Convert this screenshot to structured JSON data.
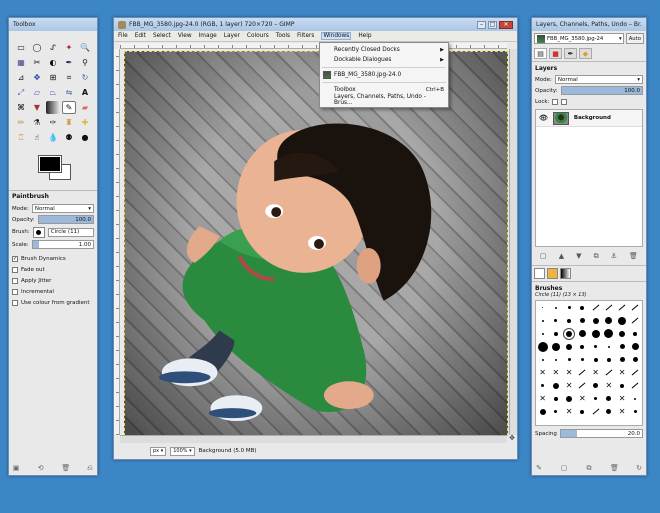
{
  "toolbox": {
    "title": "Toolbox",
    "tools": [
      "rect-select",
      "ellipse-select",
      "free-select",
      "fuzzy-select",
      "zoom",
      "select-by-color",
      "scissors",
      "foreground-select",
      "paths",
      "color-picker",
      "measure",
      "move",
      "align",
      "crop",
      "rotate",
      "scale",
      "shear",
      "perspective",
      "flip",
      "text",
      "cage",
      "bucket-fill",
      "blend",
      "paintbrush",
      "eraser",
      "pencil",
      "airbrush",
      "ink",
      "clone",
      "heal",
      "perspective-clone",
      "smudge",
      "blur",
      "dodge-burn",
      "convolve"
    ],
    "fg_color": "#000000",
    "bg_color": "#ffffff",
    "options": {
      "title": "Paintbrush",
      "mode_label": "Mode:",
      "mode_value": "Normal",
      "opacity_label": "Opacity:",
      "opacity_value": "100.0",
      "opacity_fraction": 1.0,
      "brush_label": "Brush:",
      "brush_value": "Circle (11)",
      "scale_label": "Scale:",
      "scale_value": "1.00",
      "scale_fraction": 0.1,
      "checks": [
        {
          "label": "Brush Dynamics",
          "checked": true
        },
        {
          "label": "Fade out",
          "checked": false
        },
        {
          "label": "Apply Jitter",
          "checked": false
        },
        {
          "label": "Incremental",
          "checked": false
        },
        {
          "label": "Use colour from gradient",
          "checked": false
        }
      ]
    }
  },
  "main": {
    "title": "FBB_MG_3580.jpg-24.0 (RGB, 1 layer) 720×720 – GIMP",
    "menu": [
      "File",
      "Edit",
      "Select",
      "View",
      "Image",
      "Layer",
      "Colours",
      "Tools",
      "Filters",
      "Windows",
      "Help"
    ],
    "active_menu": "Windows",
    "dropdown": {
      "items": [
        {
          "label": "Recently Closed Docks",
          "shortcut": "",
          "submenu": true
        },
        {
          "label": "Dockable Dialogues",
          "shortcut": "",
          "submenu": true
        },
        {
          "sep": true
        },
        {
          "label": "FBB_MG_3580.jpg-24.0",
          "shortcut": "",
          "submenu": false,
          "image": true
        },
        {
          "sep": true
        },
        {
          "label": "Toolbox",
          "shortcut": "Ctrl+B",
          "submenu": false
        },
        {
          "label": "Layers, Channels, Paths, Undo - Brus...",
          "shortcut": "",
          "submenu": false
        }
      ]
    },
    "status": {
      "unit": "px",
      "zoom": "100%",
      "info": "Background (5.0 MB)"
    }
  },
  "dock": {
    "title": "Layers, Channels, Paths, Undo – Br...",
    "image_select": "FBB_MG_3580.jpg-24",
    "auto_label": "Auto",
    "layers": {
      "title": "Layers",
      "mode_label": "Mode:",
      "mode_value": "Normal",
      "opacity_label": "Opacity:",
      "opacity_value": "100.0",
      "opacity_fraction": 1.0,
      "lock_label": "Lock:",
      "items": [
        {
          "name": "Background",
          "visible": true
        }
      ]
    },
    "brushes": {
      "title": "Brushes",
      "subtitle": "Circle (11) (13 × 13)",
      "spacing_label": "Spacing",
      "spacing_value": "20.0",
      "spacing_fraction": 0.2
    }
  }
}
